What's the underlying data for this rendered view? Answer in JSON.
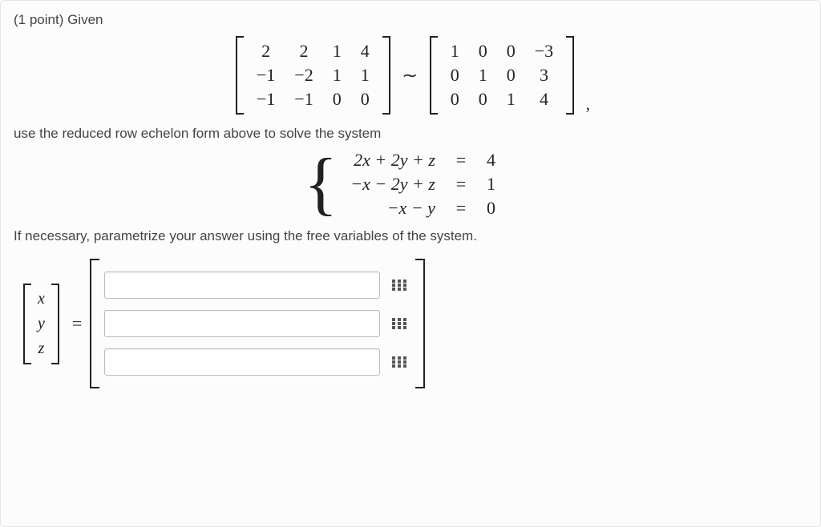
{
  "points_label": "(1 point) Given",
  "matrix_A": [
    [
      "2",
      "2",
      "1",
      "4"
    ],
    [
      "−1",
      "−2",
      "1",
      "1"
    ],
    [
      "−1",
      "−1",
      "0",
      "0"
    ]
  ],
  "tilde": "∼",
  "matrix_R": [
    [
      "1",
      "0",
      "0",
      "−3"
    ],
    [
      "0",
      "1",
      "0",
      "3"
    ],
    [
      "0",
      "0",
      "1",
      "4"
    ]
  ],
  "trailing_comma": ",",
  "instruction1": "use the reduced row echelon form above to solve the system",
  "system": {
    "rows": [
      {
        "lhs": "2x + 2y + z",
        "rhs": "4"
      },
      {
        "lhs": "−x − 2y + z",
        "rhs": "1"
      },
      {
        "lhs": "−x − y",
        "rhs": "0"
      }
    ],
    "eq": "="
  },
  "instruction2": "If necessary, parametrize your answer using the free variables of the system.",
  "answer_vector_vars": [
    "x",
    "y",
    "z"
  ],
  "equals": "=",
  "answer_inputs": {
    "x": "",
    "y": "",
    "z": ""
  },
  "icons": {
    "keypad": "keypad-icon"
  }
}
